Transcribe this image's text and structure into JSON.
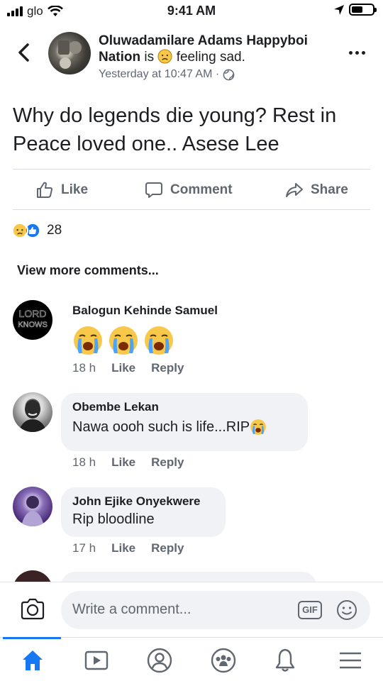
{
  "status_bar": {
    "carrier": "glo",
    "time": "9:41 AM",
    "battery_percent": 55
  },
  "post": {
    "author": "Oluwadamilare Adams Happyboi Nation",
    "is_text": "is",
    "feeling": "feeling sad.",
    "timestamp": "Yesterday at 10:47 AM ·",
    "body": "Why do legends die young? Rest in Peace loved one.. Asese Lee",
    "audience_icon": "globe-icon"
  },
  "actions": {
    "like": "Like",
    "comment": "Comment",
    "share": "Share"
  },
  "reactions": {
    "count": "28",
    "types": [
      "sad",
      "like"
    ]
  },
  "view_more": "View more comments...",
  "comments": [
    {
      "author": "Balogun Kehinde Samuel",
      "avatar_text": "LORD\nKNOWS",
      "text": "",
      "emojis": [
        "crying",
        "crying",
        "crying"
      ],
      "time": "18 h",
      "like": "Like",
      "reply": "Reply"
    },
    {
      "author": "Obembe Lekan",
      "text": "Nawa oooh such is life...RIP",
      "emojis": [
        "crying"
      ],
      "time": "18 h",
      "like": "Like",
      "reply": "Reply"
    },
    {
      "author": "John Ejike Onyekwere",
      "text": "Rip bloodline",
      "time": "17 h",
      "like": "Like",
      "reply": "Reply"
    }
  ],
  "composer": {
    "placeholder": "Write a comment...",
    "gif_label": "GIF"
  },
  "tabs": [
    "home-icon",
    "video-icon",
    "profile-icon",
    "groups-icon",
    "notifications-icon",
    "menu-icon"
  ],
  "colors": {
    "accent": "#1877f2",
    "meta": "#606770",
    "bubble": "#f0f2f5"
  }
}
